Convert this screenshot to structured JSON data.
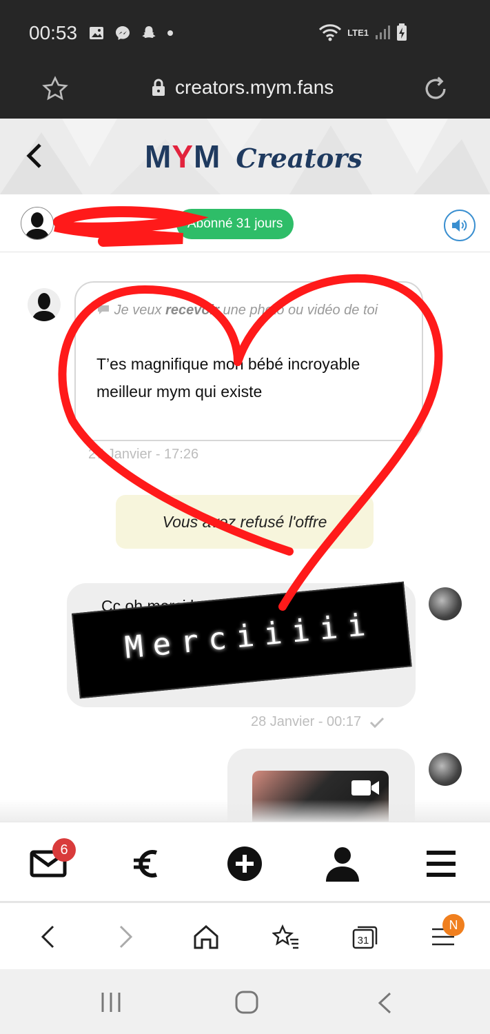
{
  "status": {
    "time": "00:53",
    "network": "LTE1"
  },
  "browser": {
    "url": "creators.mym.fans"
  },
  "header": {
    "logo_mym_1": "M",
    "logo_mym_y": "Y",
    "logo_mym_2": "M",
    "logo_creators": "Creators"
  },
  "chat_header": {
    "subscription": "Abonné 31 jours"
  },
  "messages": {
    "incoming": {
      "request_prefix": "Je veux ",
      "request_bold": "recevoir",
      "request_suffix": " une photo ou vidéo de toi",
      "text": "T’es magnifique mon bébé incroyable meilleur mym qui existe",
      "timestamp": "27 Janvier - 17:26"
    },
    "system": {
      "text": "Vous avez refusé l'offre"
    },
    "outgoing": {
      "text": "Cc oh merci bcp ;) bienvenue sur mon feed ;) j'te...",
      "timestamp": "28 Janvier - 00:17"
    }
  },
  "sticker": {
    "text": "Merciiiii"
  },
  "app_nav": {
    "inbox_count": "6"
  },
  "browser_nav": {
    "tabs_count": "31",
    "menu_badge": "N"
  },
  "colors": {
    "brand_navy": "#1f3a5f",
    "brand_red": "#e2233d",
    "subscription_green": "#2ebd68",
    "heart_red": "#ff1a1a"
  }
}
